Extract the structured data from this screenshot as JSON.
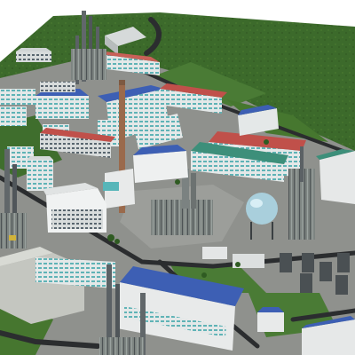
{
  "scene": {
    "subject": "industrial-plant-3d-model",
    "colors": {
      "grass": "#3d6a2c",
      "grass_light": "#4c7d37",
      "road": "#2c2e30",
      "pavement": "#8d8f8c",
      "roof_blue": "#3d5fb4",
      "roof_red": "#c0504a",
      "roof_teal": "#3d8f7a",
      "wall": "#e6e8e8",
      "window_teal": "#57b6b9",
      "steel": "#5b6165"
    }
  }
}
